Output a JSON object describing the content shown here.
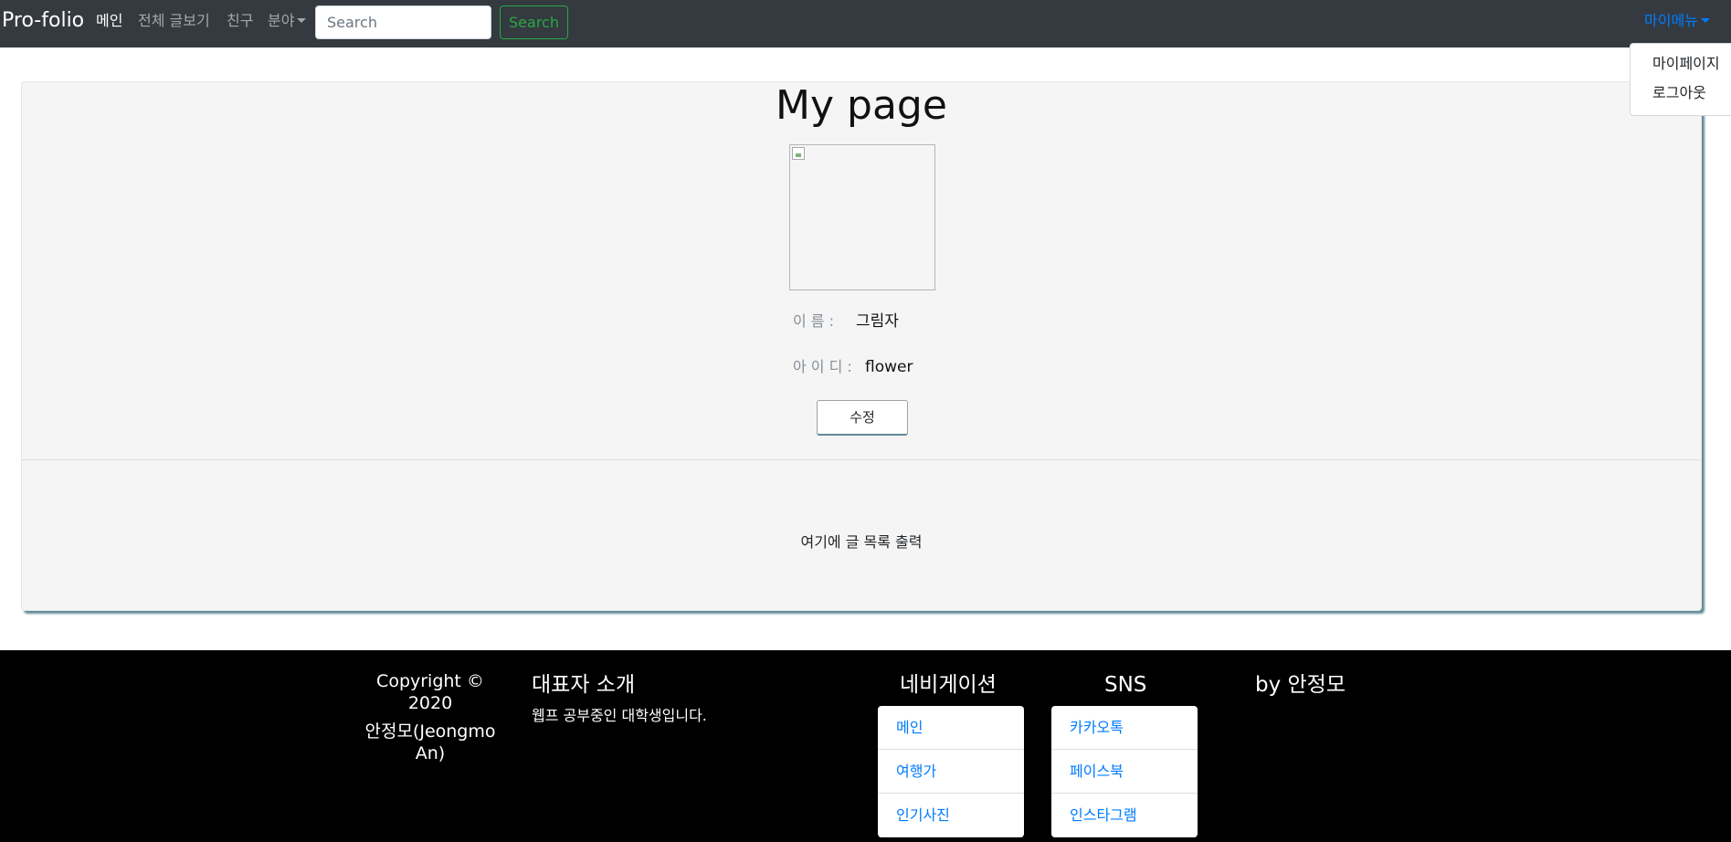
{
  "navbar": {
    "brand": "Pro-folio",
    "links": [
      "메인",
      "전체 글보기",
      "친구"
    ],
    "category_dropdown": "분야",
    "search_placeholder": "Search",
    "search_button": "Search",
    "user_menu": "마이메뉴"
  },
  "user_dropdown": {
    "items": [
      "마이페이지",
      "로그아웃"
    ]
  },
  "profile": {
    "title": "My page",
    "name_label": "이 름 :",
    "name_value": "그림자",
    "id_label": "아 이 디 :",
    "id_value": "flower",
    "edit_button": "수정",
    "posts_placeholder": "여기에 글 목록 출력"
  },
  "footer": {
    "copyright_line1": "Copyright © 2020",
    "copyright_line2": "안정모(Jeongmo An)",
    "intro_heading": "대표자 소개",
    "intro_text": "웹프 공부중인 대학생입니다.",
    "nav_heading": "네비게이션",
    "nav_links": [
      "메인",
      "여행가",
      "인기사진"
    ],
    "sns_heading": "SNS",
    "sns_links": [
      "카카오톡",
      "페이스북",
      "인스타그램"
    ],
    "author": "by 안정모"
  },
  "colors": {
    "navbar_bg": "#343a40",
    "link_blue": "#007bff",
    "search_green": "#28a745",
    "card_bg": "#f5f5f5",
    "card_shadow": "#5e8b96",
    "footer_bg": "#000000"
  }
}
